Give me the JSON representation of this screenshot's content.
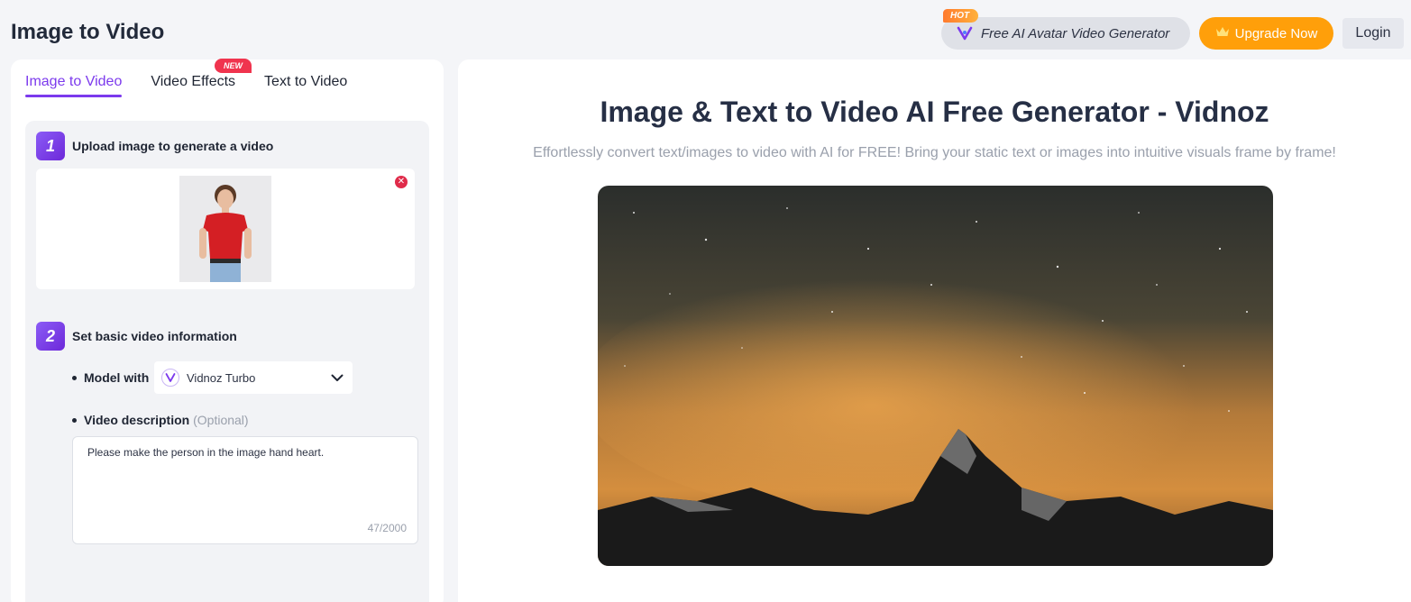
{
  "header": {
    "title": "Image to Video",
    "hot_badge": "HOT",
    "avatar_pill_label": "Free AI Avatar Video Generator",
    "upgrade_label": "Upgrade Now",
    "login_label": "Login"
  },
  "tabs": [
    {
      "label": "Image to Video",
      "active": true
    },
    {
      "label": "Video Effects",
      "badge": "NEW"
    },
    {
      "label": "Text to Video"
    }
  ],
  "steps": {
    "step1": {
      "number": "1",
      "label": "Upload image to generate a video"
    },
    "step2": {
      "number": "2",
      "label": "Set basic video information"
    }
  },
  "form": {
    "model_label": "Model with",
    "model_value": "Vidnoz Turbo",
    "desc_label": "Video description",
    "desc_optional": "(Optional)",
    "desc_value": "Please make the person in the image hand heart.",
    "desc_count": "47/2000"
  },
  "hero": {
    "title": "Image & Text to Video AI Free Generator - Vidnoz",
    "subtitle": "Effortlessly convert text/images to video with AI for FREE! Bring your static text or images into intuitive visuals frame by frame!"
  },
  "colors": {
    "accent": "#7c3aed",
    "upgrade": "#ff9f0a",
    "new_badge": "#f0344e"
  }
}
